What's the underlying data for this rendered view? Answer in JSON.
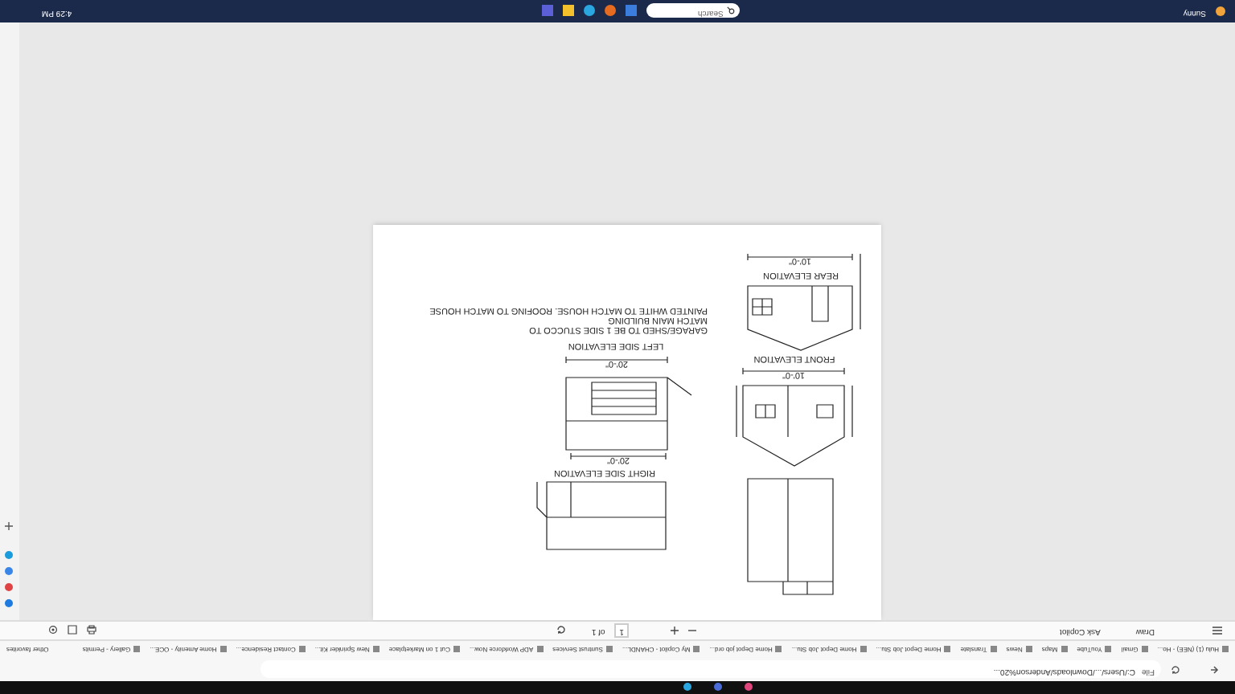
{
  "address_bar": {
    "scheme": "File",
    "url": "C:/Users/.../Downloads/Anderson%20..."
  },
  "bookmarks": [
    "Hulu (1) (NEE) - Ho...",
    "Gmail",
    "YouTube",
    "Maps",
    "News",
    "Translate",
    "Home Depot Job Stu...",
    "Home Depot Job Stu...",
    "Home Depot job ord...",
    "My Copilot - CHANDL...",
    "Suntrust Services",
    "ADP Workforce Now...",
    "Cut 1 on Marketplace",
    "New Sprinkler Kit...",
    "Contact Residence...",
    "Home Amenity - OCE...",
    "Gallery - Permits"
  ],
  "other_favorites": "Other favorites",
  "pdf_toolbar": {
    "draw": "Draw",
    "ask_copilot": "Ask Copilot",
    "page": "1",
    "page_total": "of 1"
  },
  "drawing": {
    "note_lines": [
      "GARAGE/SHED TO BE 1 SIDE STUCCO TO",
      "MATCH MAIN BUILDING",
      "PAINTED WHITE TO MATCH HOUSE. ROOFING TO MATCH HOUSE"
    ],
    "views": [
      {
        "title": "REAR ELEVATION",
        "dimension": "10'-0\""
      },
      {
        "title": "FRONT ELEVATION",
        "dimension": "10'-0\""
      },
      {
        "title": "LEFT SIDE ELEVATION",
        "dimension": "20'-0\""
      },
      {
        "title": "RIGHT SIDE ELEVATION",
        "dimension": "20'-0\""
      }
    ]
  },
  "taskbar": {
    "search_placeholder": "Search",
    "weather": "Sunny",
    "time": "4:29 PM"
  }
}
